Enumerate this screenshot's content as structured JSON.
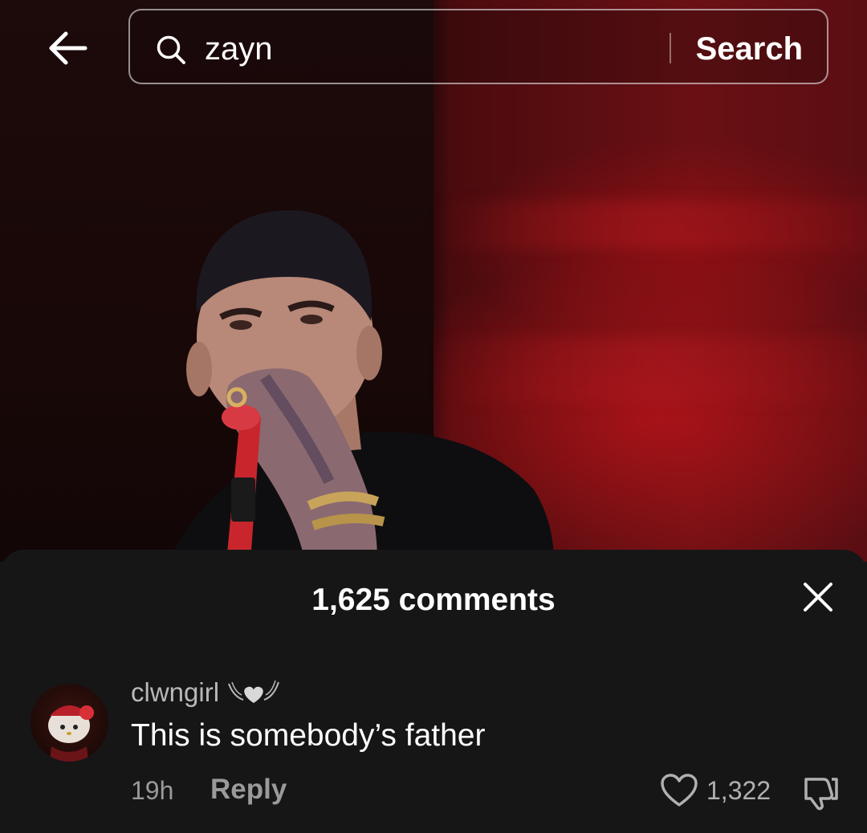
{
  "search": {
    "query": "zayn",
    "button_label": "Search"
  },
  "icons": {
    "back": "arrow-left-icon",
    "search": "magnifier-icon",
    "close": "close-icon",
    "like": "heart-outline-icon",
    "dislike": "thumbs-down-icon",
    "username_decoration": "winged-heart-icon"
  },
  "comments_sheet": {
    "title": "1,625 comments",
    "comments": [
      {
        "username": "clwngirl",
        "text": "This is somebody’s father",
        "time": "19h",
        "reply_label": "Reply",
        "likes": "1,322"
      }
    ]
  },
  "colors": {
    "sheet_background": "#161616",
    "stage_red": "#8a1216",
    "secondary_text": "#9a9a9a"
  }
}
